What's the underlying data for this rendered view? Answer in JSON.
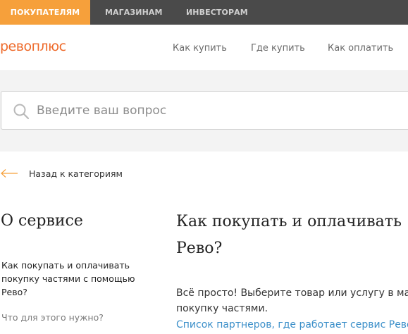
{
  "top_tabs": [
    {
      "label": "ПОКУПАТЕЛЯМ",
      "active": true
    },
    {
      "label": "МАГАЗИНАМ",
      "active": false
    },
    {
      "label": "ИНВЕСТОРАМ",
      "active": false
    }
  ],
  "logo": {
    "text": "ревоплюс"
  },
  "nav": [
    "Как купить",
    "Где купить",
    "Как оплатить"
  ],
  "search": {
    "placeholder": "Введите ваш вопрос",
    "value": ""
  },
  "back": {
    "label": "Назад к категориям"
  },
  "sidebar": {
    "title": "О сервисе",
    "items": [
      "Как покупать и оплачивать покупку частями с помощью Рево?",
      "Что для этого нужно?"
    ]
  },
  "article": {
    "title_line1": "Как покупать и оплачивать",
    "title_line2": "Рево?",
    "text": "Всё просто! Выберите товар или услугу в  ма покупку частями.",
    "link": "Список партнеров, где работает сервис Рево"
  },
  "colors": {
    "accent": "#f6a03b",
    "logo": "#ee6a2a",
    "link": "#3b8fc9",
    "topbar": "#4a4a4a"
  }
}
